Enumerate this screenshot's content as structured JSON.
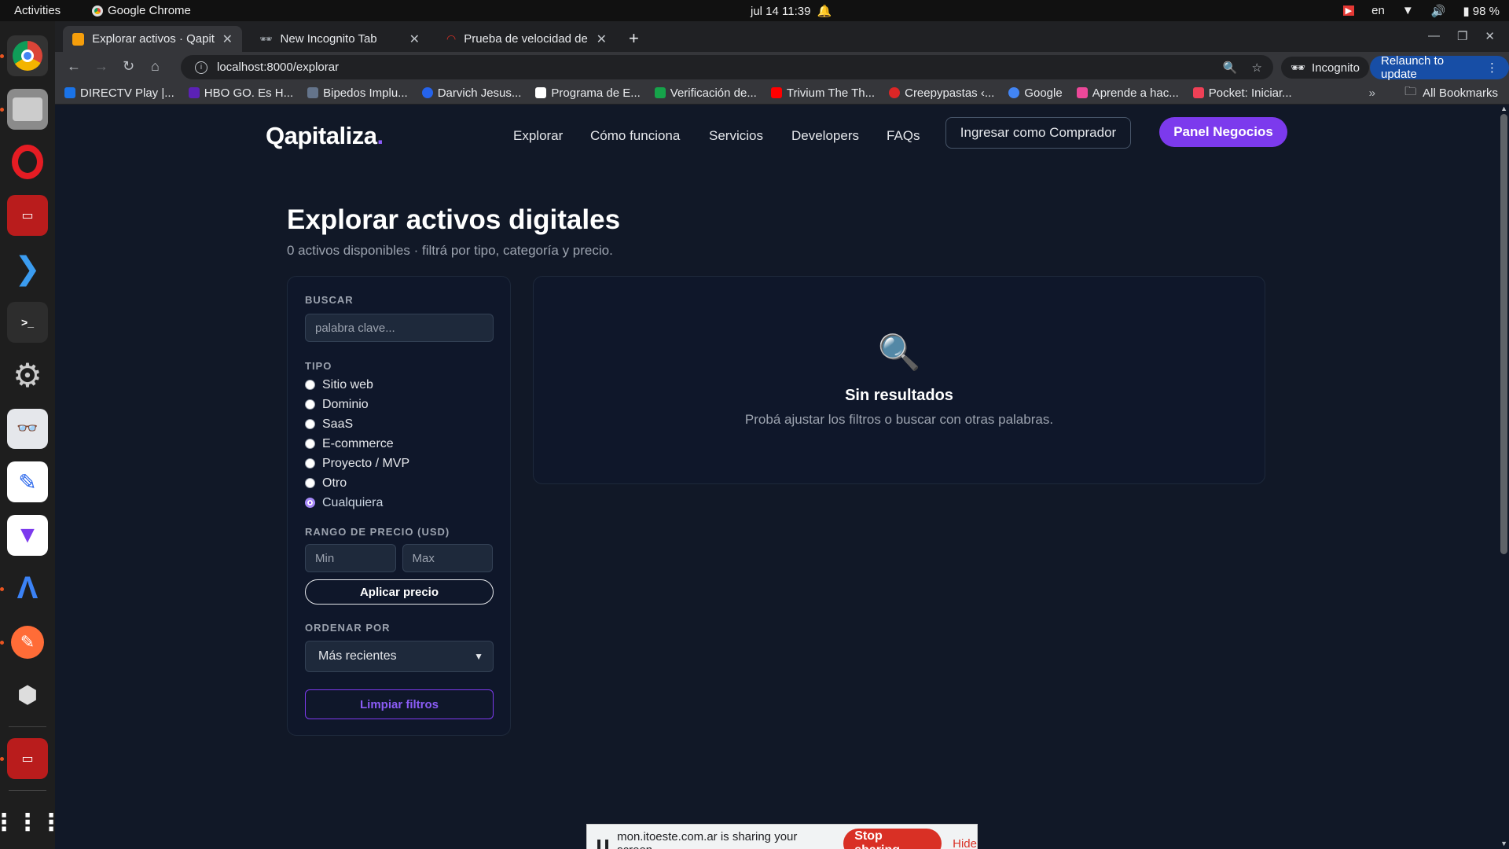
{
  "topbar": {
    "activities": "Activities",
    "app_name": "Google Chrome",
    "clock": "jul 14  11:39",
    "lang": "en",
    "battery": "98 %"
  },
  "tabs": [
    {
      "title": "Explorar activos · Qapita",
      "favicon_color": "#f59e0b"
    },
    {
      "title": "New Incognito Tab",
      "favicon_color": "#9aa0a6"
    },
    {
      "title": "Prueba de velocidad de I",
      "favicon_color": "#d93025"
    }
  ],
  "toolbar": {
    "url": "localhost:8000/explorar",
    "incognito": "Incognito",
    "relaunch": "Relaunch to update"
  },
  "bookmarks": [
    {
      "label": "DIRECTV Play |...",
      "color": "#1a73e8"
    },
    {
      "label": "HBO GO. Es H...",
      "color": "#5b21b6"
    },
    {
      "label": "Bipedos Implu...",
      "color": "#64748b"
    },
    {
      "label": "Darvich Jesus...",
      "color": "#2563eb"
    },
    {
      "label": "Programa de E...",
      "color": "#ffffff"
    },
    {
      "label": "Verificación de...",
      "color": "#16a34a"
    },
    {
      "label": "Trivium The Th...",
      "color": "#ff0000"
    },
    {
      "label": "Creepypastas ‹...",
      "color": "#dc2626"
    },
    {
      "label": "Google",
      "color": "#4285f4"
    },
    {
      "label": "Aprende a hac...",
      "color": "#ec4899"
    },
    {
      "label": "Pocket: Iniciar...",
      "color": "#ef4056"
    }
  ],
  "bookmarks_all": "All Bookmarks",
  "site": {
    "brand": "Qapitaliza",
    "brand_dot": ".",
    "nav": [
      "Explorar",
      "Cómo funciona",
      "Servicios",
      "Developers",
      "FAQs"
    ],
    "login_button": "Ingresar como Comprador",
    "panel_button": "Panel Negocios"
  },
  "page": {
    "title": "Explorar activos digitales",
    "subtitle": "0 activos disponibles · filtrá por tipo, categoría y precio."
  },
  "filters": {
    "search_label": "BUSCAR",
    "search_placeholder": "palabra clave...",
    "type_label": "TIPO",
    "types": [
      "Sitio web",
      "Dominio",
      "SaaS",
      "E-commerce",
      "Proyecto / MVP",
      "Otro",
      "Cualquiera"
    ],
    "type_selected": "Cualquiera",
    "price_label": "RANGO DE PRECIO (USD)",
    "min_placeholder": "Min",
    "max_placeholder": "Max",
    "apply_button": "Aplicar precio",
    "sort_label": "ORDENAR POR",
    "sort_value": "Más recientes",
    "clear_button": "Limpiar filtros"
  },
  "results": {
    "empty_title": "Sin resultados",
    "empty_sub": "Probá ajustar los filtros o buscar con otras palabras."
  },
  "sharebar": {
    "message": "mon.itoeste.com.ar is sharing your screen.",
    "stop": "Stop sharing",
    "hide": "Hide"
  }
}
